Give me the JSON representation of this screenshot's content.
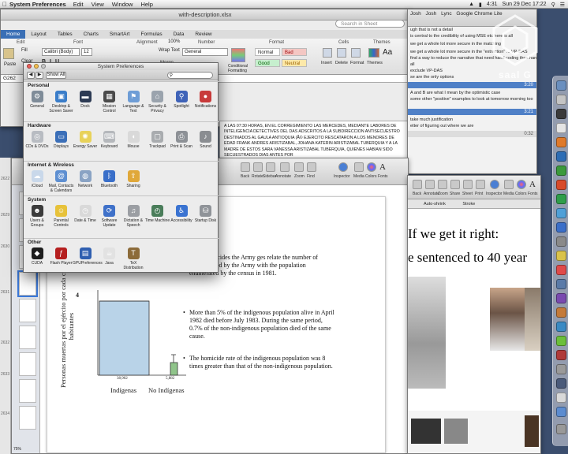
{
  "menubar": {
    "app": "System Preferences",
    "menus": [
      "Edit",
      "View",
      "Window",
      "Help"
    ],
    "clock": "Sun 29 Dec 17:22",
    "battery": "4:31"
  },
  "excel": {
    "window_title": "with-description.xlsx",
    "search_placeholder": "Search in Sheet",
    "tabs": [
      "Home",
      "Layout",
      "Tables",
      "Charts",
      "SmartArt",
      "Formulas",
      "Data",
      "Review"
    ],
    "font_name": "Calibri (Body)",
    "font_size": "12",
    "number_format": "General",
    "zoom": "100%",
    "cell_ref": "G262",
    "wrap_text": "Wrap Text",
    "merge": "Merge",
    "paste": "Paste",
    "clear": "Clear",
    "fill": "Fill",
    "groups": [
      "Edit",
      "Font",
      "Alignment",
      "Number",
      "Format",
      "Cells",
      "Themes"
    ],
    "styles": [
      {
        "label": "Normal",
        "color": "#ffffff"
      },
      {
        "label": "Bad",
        "color": "#f4c7c3"
      },
      {
        "label": "Good",
        "color": "#c6efce"
      },
      {
        "label": "Neutral",
        "color": "#fde9a9"
      }
    ],
    "cond_format": "Conditional Formatting",
    "cells_actions": [
      "Insert",
      "Delete",
      "Format"
    ],
    "themes_label": "Themes"
  },
  "sheet_text": "A LAS 07:30 HORAS, EN EL CORREGIMIENTO LAS MERCEDES, MEDIANTE LABORES DE INTELIGENCIA DETECTIVES DEL DAS ADSCRITOS A LA SUBDIRECCION ANTISECUESTRO DESTINADOS AL GAULA ANTIOQUIA (Ã© EJERCITO RESCATARON A LOS MENORES DE EDAD FRANK ANDRES ARISTIZABAL, JOHANA KATERIN ARISTIZABAL TUBERQUIA Y A LA MADRE DE ESTOS SARA VANESSA ARISTIZABAL TUBERQUIA, QUIENES HABIAN SIDO SECUESTRADOS DIAS ANTES POR",
  "chat": {
    "tabs": [
      "Josh",
      "Josh",
      "Lync",
      "Google Chrome Lite"
    ],
    "lines": [
      "ugh that is not a detail",
      "is central to the credibility of using MSE etc here is all",
      "",
      "we get a whole lot more secure in the matching",
      "",
      "we get a whole lot more secure in the \"extraction\" ... VP-DAS",
      "find a way to reduce the narrative that need hand coding then hand",
      "all",
      "exclude VP-DAS",
      "se are the only options"
    ],
    "ts1": "3:20",
    "lines2": [
      "A and B are what I mean by the optimistic case",
      "some other \"positive\" examples to look at tomorrow morning too"
    ],
    "ts2": "3:21",
    "lines3": [
      "take much justification",
      "etter of figuring out where we are"
    ],
    "ts3": "0:32",
    "watermark": "saal G"
  },
  "preview_left": {
    "toolbar": [
      "Back",
      "Rotate",
      "Sidebar",
      "Annotate",
      "Zoom",
      "Find",
      "Inspector",
      "Media",
      "Colors",
      "Fonts"
    ],
    "chart": {
      "ylabel": "Personas muertas por el ejército por cada cien habitantes",
      "bars": [
        {
          "label": "Indígenas",
          "value_label": "38,902"
        },
        {
          "label": "No Indígenas",
          "value_label": "5,882"
        }
      ]
    },
    "bullets": [
      "those homicides the Army ges relate the number of people killed by the Army with the population enumerated by the census in 1981.",
      "More than 5% of the indigenous population alive in April 1982 died before July 1983. During the same period, 0.7% of the non-indigenous population died of the same cause.",
      "The homicide rate of the indigenous population was 8 times greater than that of the non-indigenous population."
    ],
    "zoom": "75%"
  },
  "preview_right": {
    "toolbar": [
      "Back",
      "Annotate",
      "Zoom",
      "Share",
      "Sheet",
      "Print",
      "Inspector",
      "Media",
      "Colors",
      "Fonts"
    ],
    "autoshrink": "Auto-shrink",
    "stroke": "Stroke",
    "title1": "If we get it right:",
    "title2": "e sentenced to 40 year"
  },
  "syspref": {
    "title": "System Preferences",
    "show_all": "Show All",
    "sections": [
      {
        "title": "Personal",
        "items": [
          {
            "label": "General",
            "icon": "general-icon",
            "color": "#7f8c99"
          },
          {
            "label": "Desktop & Screen Saver",
            "icon": "desktop-icon",
            "color": "#3a7dc9"
          },
          {
            "label": "Dock",
            "icon": "dock-icon",
            "color": "#2d3b54"
          },
          {
            "label": "Mission Control",
            "icon": "mission-control-icon",
            "color": "#4b4b4b"
          },
          {
            "label": "Language & Text",
            "icon": "language-icon",
            "color": "#6e9dd6"
          },
          {
            "label": "Security & Privacy",
            "icon": "security-icon",
            "color": "#9aa3ad"
          },
          {
            "label": "Spotlight",
            "icon": "spotlight-icon",
            "color": "#3f63b8"
          },
          {
            "label": "Notifications",
            "icon": "notifications-icon",
            "color": "#c83a3a"
          }
        ]
      },
      {
        "title": "Hardware",
        "items": [
          {
            "label": "CDs & DVDs",
            "icon": "cd-icon",
            "color": "#b8bcc2"
          },
          {
            "label": "Displays",
            "icon": "displays-icon",
            "color": "#3b6fb8"
          },
          {
            "label": "Energy Saver",
            "icon": "energy-saver-icon",
            "color": "#e8d25a"
          },
          {
            "label": "Keyboard",
            "icon": "keyboard-icon",
            "color": "#b5b8bc"
          },
          {
            "label": "Mouse",
            "icon": "mouse-icon",
            "color": "#d9d9d9"
          },
          {
            "label": "Trackpad",
            "icon": "trackpad-icon",
            "color": "#a9acaf"
          },
          {
            "label": "Print & Scan",
            "icon": "printer-icon",
            "color": "#8d9196"
          },
          {
            "label": "Sound",
            "icon": "sound-icon",
            "color": "#8a8d91"
          }
        ]
      },
      {
        "title": "Internet & Wireless",
        "items": [
          {
            "label": "iCloud",
            "icon": "icloud-icon",
            "color": "#c9d8ea"
          },
          {
            "label": "Mail, Contacts & Calendars",
            "icon": "mail-icon",
            "color": "#5e8fd1"
          },
          {
            "label": "Network",
            "icon": "network-icon",
            "color": "#8aa3c4"
          },
          {
            "label": "Bluetooth",
            "icon": "bluetooth-icon",
            "color": "#3a6fc9"
          },
          {
            "label": "Sharing",
            "icon": "sharing-icon",
            "color": "#e0a83a"
          }
        ]
      },
      {
        "title": "System",
        "items": [
          {
            "label": "Users & Groups",
            "icon": "users-icon",
            "color": "#3b3b3b"
          },
          {
            "label": "Parental Controls",
            "icon": "parental-controls-icon",
            "color": "#e7c23a"
          },
          {
            "label": "Date & Time",
            "icon": "date-time-icon",
            "color": "#d9d9d9"
          },
          {
            "label": "Software Update",
            "icon": "software-update-icon",
            "color": "#3f71c9"
          },
          {
            "label": "Dictation & Speech",
            "icon": "dictation-icon",
            "color": "#9b9ea3"
          },
          {
            "label": "Time Machine",
            "icon": "time-machine-icon",
            "color": "#4a7d5a"
          },
          {
            "label": "Accessibility",
            "icon": "accessibility-icon",
            "color": "#3a73d1"
          },
          {
            "label": "Startup Disk",
            "icon": "startup-disk-icon",
            "color": "#8f9398"
          }
        ]
      },
      {
        "title": "Other",
        "items": [
          {
            "label": "CUDA",
            "icon": "cuda-icon",
            "color": "#1d1d1d"
          },
          {
            "label": "Flash Player",
            "icon": "flash-icon",
            "color": "#b51f1f"
          },
          {
            "label": "GPUPreferences",
            "icon": "gpu-icon",
            "color": "#2f5fb0"
          },
          {
            "label": "Java",
            "icon": "java-icon",
            "color": "#e2e2e2"
          },
          {
            "label": "TeX Distribution",
            "icon": "tex-icon",
            "color": "#8c6b3a"
          }
        ]
      }
    ]
  }
}
